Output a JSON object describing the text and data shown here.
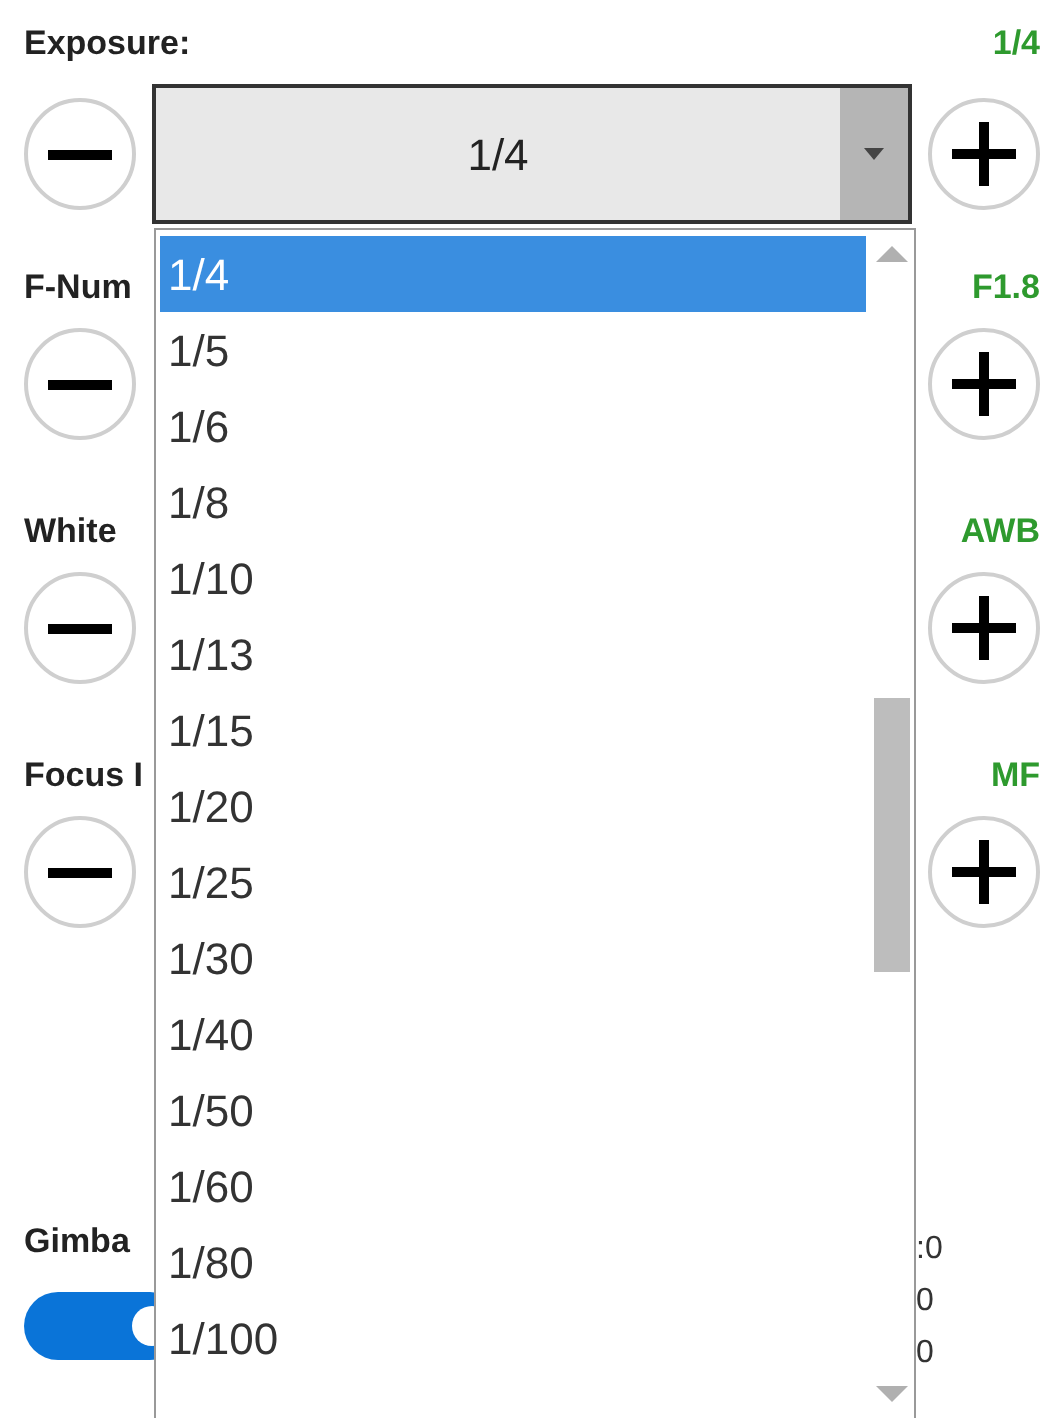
{
  "sections": [
    {
      "kind": "combo",
      "label": "Exposure:",
      "value": "1/4",
      "combo_value": "1/4"
    },
    {
      "kind": "buttons",
      "label": "F-Num",
      "value": "F1.8"
    },
    {
      "kind": "buttons",
      "label": "White",
      "value": "AWB"
    },
    {
      "kind": "buttons",
      "label": "Focus I",
      "value": "MF"
    }
  ],
  "dropdown": {
    "items": [
      {
        "text": "1/4",
        "selected": true
      },
      {
        "text": "1/5",
        "selected": false
      },
      {
        "text": "1/6",
        "selected": false
      },
      {
        "text": "1/8",
        "selected": false
      },
      {
        "text": "1/10",
        "selected": false
      },
      {
        "text": "1/13",
        "selected": false
      },
      {
        "text": "1/15",
        "selected": false
      },
      {
        "text": "1/20",
        "selected": false
      },
      {
        "text": "1/25",
        "selected": false
      },
      {
        "text": "1/30",
        "selected": false
      },
      {
        "text": "1/40",
        "selected": false
      },
      {
        "text": "1/50",
        "selected": false
      },
      {
        "text": "1/60",
        "selected": false
      },
      {
        "text": "1/80",
        "selected": false
      },
      {
        "text": "1/100",
        "selected": false
      }
    ]
  },
  "gimbal": {
    "label": "Gimba",
    "on": true,
    "readings": [
      ":0",
      "0",
      "0"
    ]
  }
}
